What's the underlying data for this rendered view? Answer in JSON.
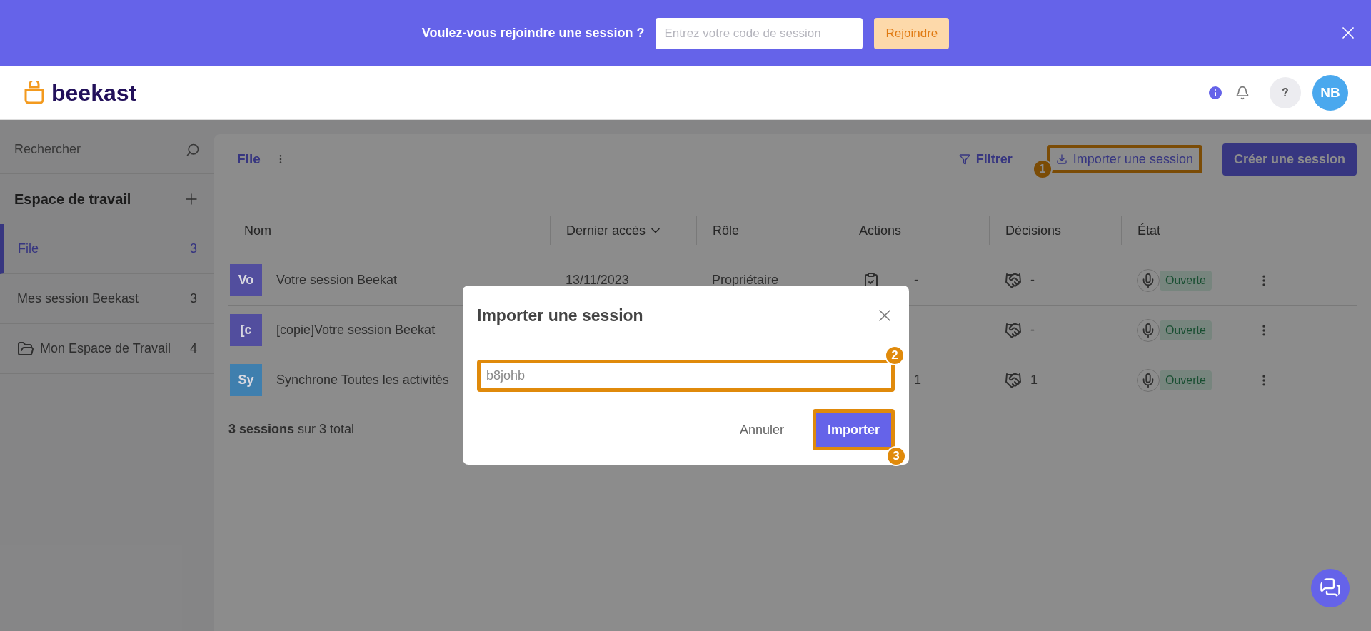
{
  "banner": {
    "question": "Voulez-vous rejoindre une session ?",
    "code_field": {
      "placeholder": "Entrez votre code de session"
    },
    "join_button": "Rejoindre"
  },
  "header": {
    "logo": "beekast",
    "help": "?",
    "avatar": "NB"
  },
  "sidebar": {
    "search_placeholder": "Rechercher",
    "section": "Espace de travail",
    "items": [
      {
        "label": "File",
        "count": "3",
        "selected": true,
        "kind": "list"
      },
      {
        "label": "Mes session Beekast",
        "count": "3",
        "selected": false,
        "kind": "list"
      },
      {
        "label": "Mon Espace de Travail",
        "count": "4",
        "selected": false,
        "kind": "folder"
      }
    ]
  },
  "main": {
    "title": "File",
    "filter": "Filtrer",
    "import_button": {
      "label": "Importer une session",
      "highlight": true,
      "step": "1"
    },
    "create_button": "Créer une session",
    "table": {
      "columns": [
        "Nom",
        "Dernier accès",
        "Rôle",
        "Actions",
        "Décisions",
        "État"
      ],
      "rows": [
        {
          "initials": "Vo",
          "color": "#524e9e",
          "name": "Votre session Beekat",
          "date": "13/11/2023",
          "role": "Propriétaire",
          "actions": "-",
          "actions_icon": true,
          "decisions": "-",
          "state": "Ouverte"
        },
        {
          "initials": "[c",
          "color": "#524e9e",
          "name": "[copie]Votre session Beekat",
          "decisions": "-",
          "state": "Ouverte"
        },
        {
          "initials": "Sy",
          "color": "#3f7fae",
          "name": "Synchrone Toutes les activités",
          "actions": "1",
          "decisions": "1",
          "state": "Ouverte"
        }
      ]
    },
    "footer_count": "**3 sessions** sur 3 total"
  },
  "modal": {
    "title": "Importer une session",
    "input": {
      "value": "b8johb",
      "highlight": true,
      "step": "2"
    },
    "cancel": "Annuler",
    "confirm": {
      "label": "Importer",
      "highlight": true,
      "step": "3"
    }
  }
}
